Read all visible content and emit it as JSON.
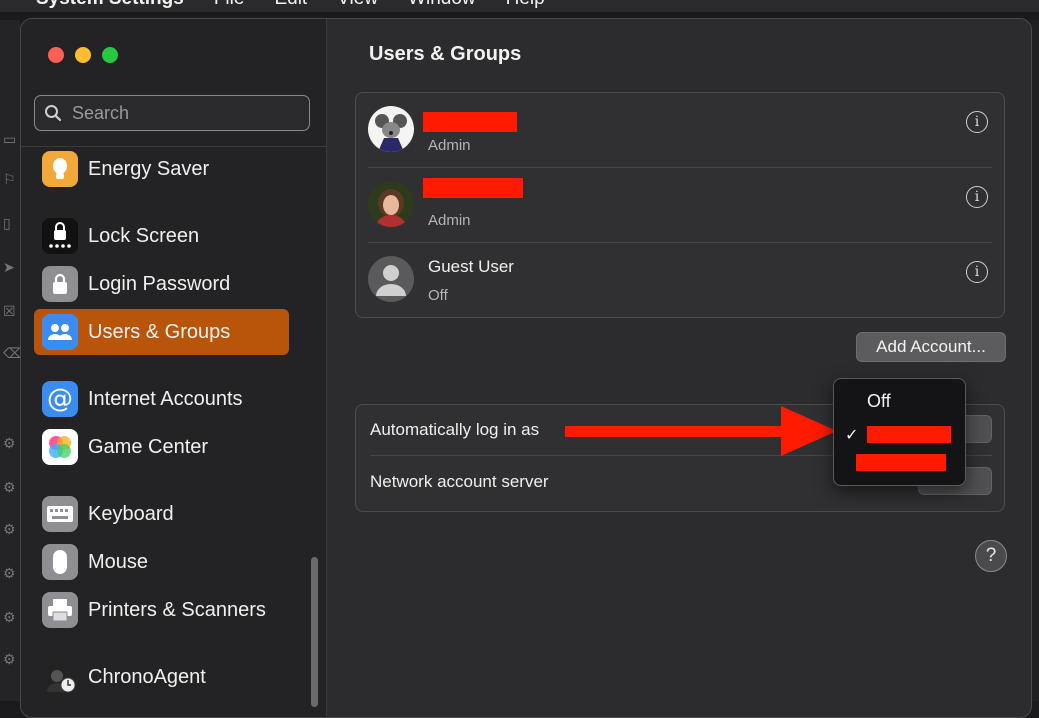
{
  "menubar": {
    "app_name": "System Settings",
    "items": [
      "File",
      "Edit",
      "View",
      "Window",
      "Help"
    ]
  },
  "sidebar": {
    "search_placeholder": "Search",
    "items": [
      {
        "label": "Energy Saver",
        "icon": "lightbulb-icon",
        "color": "#f2a93b"
      },
      {
        "label": "Lock Screen",
        "icon": "lock-screen-icon",
        "color": "#111111"
      },
      {
        "label": "Login Password",
        "icon": "lock-icon",
        "color": "#8e8e93"
      },
      {
        "label": "Users & Groups",
        "icon": "users-icon",
        "color": "#3a8cf0",
        "active": true
      },
      {
        "label": "Internet Accounts",
        "icon": "at-icon",
        "color": "#3a8cf0"
      },
      {
        "label": "Game Center",
        "icon": "game-center-icon",
        "color": "#ffffff"
      },
      {
        "label": "Keyboard",
        "icon": "keyboard-icon",
        "color": "#8e8e93"
      },
      {
        "label": "Mouse",
        "icon": "mouse-icon",
        "color": "#8e8e93"
      },
      {
        "label": "Printers & Scanners",
        "icon": "printer-icon",
        "color": "#8e8e93"
      },
      {
        "label": "ChronoAgent",
        "icon": "chronoagent-icon",
        "color": "#333333"
      }
    ]
  },
  "main": {
    "title": "Users & Groups",
    "users": [
      {
        "name": "",
        "role": "Admin",
        "redacted": true,
        "avatar": "mouse-cartoon-avatar"
      },
      {
        "name": "",
        "role": "Admin",
        "redacted": true,
        "avatar": "photo-avatar"
      },
      {
        "name": "Guest User",
        "role": "Off",
        "redacted": false,
        "avatar": "guest-avatar"
      }
    ],
    "add_account_label": "Add Account...",
    "settings": {
      "auto_login_label": "Automatically log in as",
      "network_server_label": "Network account server"
    },
    "help_label": "?"
  },
  "auto_login_menu": {
    "items": [
      {
        "label": "Off",
        "checked": false
      },
      {
        "label": "",
        "checked": true,
        "redacted": true
      },
      {
        "label": "",
        "checked": false,
        "redacted": true
      }
    ],
    "check_glyph": "✓"
  },
  "annotation_color": "#ff1a00"
}
